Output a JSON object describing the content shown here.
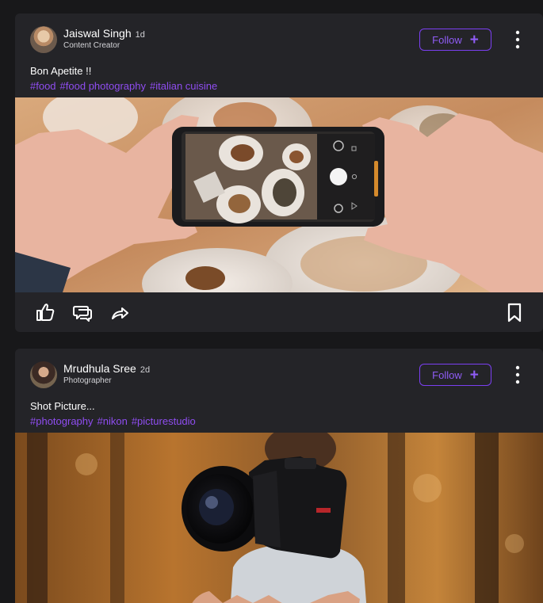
{
  "colors": {
    "background": "#18181a",
    "card": "#242428",
    "accent": "#7b3ff2",
    "hashtag": "#8f4df0",
    "text": "#ffffff"
  },
  "posts": [
    {
      "author": "Jaiswal Singh",
      "time": "1d",
      "role": "Content Creator",
      "follow_label": "Follow",
      "caption": "Bon Apetite !!",
      "hashtags": [
        "#food",
        "#food photography",
        "#italian cuisine"
      ],
      "image": "food-photography-photo",
      "icons": [
        "thumbs-up-icon",
        "comment-icon",
        "share-icon",
        "bookmark-icon",
        "more-options-icon"
      ]
    },
    {
      "author": "Mrudhula Sree",
      "time": "2d",
      "role": "Photographer",
      "follow_label": "Follow",
      "caption": "Shot Picture...",
      "hashtags": [
        "#photography",
        "#nikon",
        "#picturestudio"
      ],
      "image": "camera-photography-photo",
      "icons": [
        "more-options-icon"
      ]
    }
  ]
}
